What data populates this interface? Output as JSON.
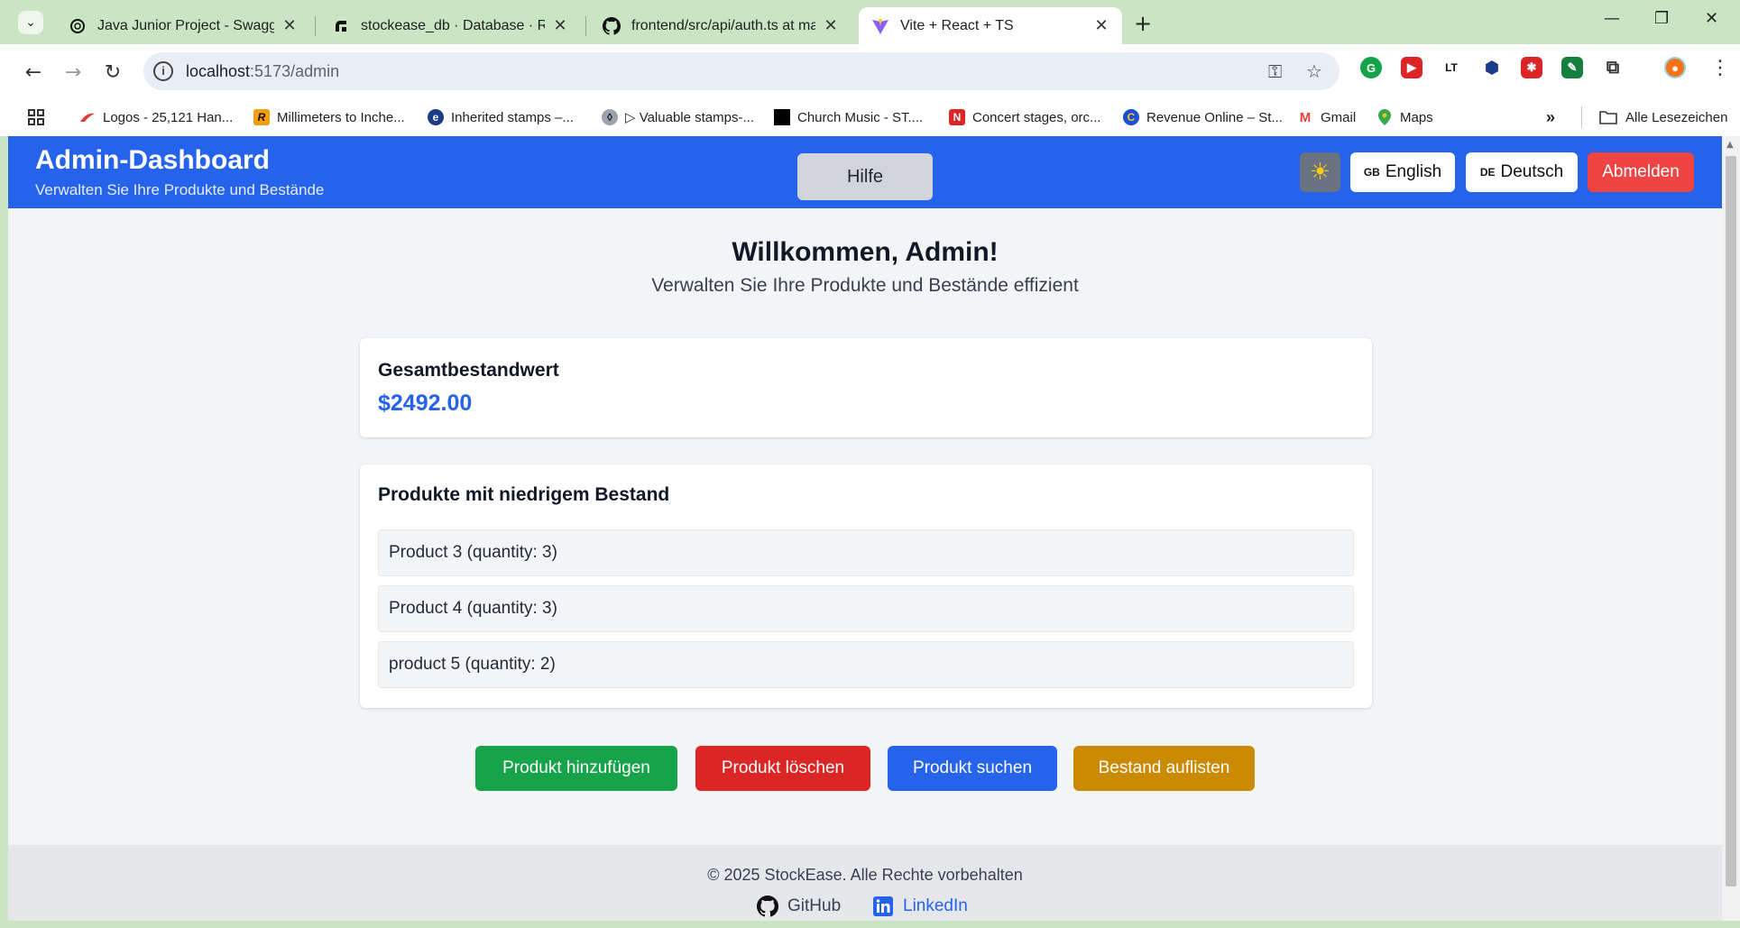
{
  "browser": {
    "tabs": [
      {
        "title": "Java Junior Project - Swagger A",
        "favicon": "openai-icon",
        "active": false
      },
      {
        "title": "stockease_db · Database · Ren",
        "favicon": "render-icon",
        "active": false
      },
      {
        "title": "frontend/src/api/auth.ts at mast",
        "favicon": "github-icon",
        "active": false
      },
      {
        "title": "Vite + React + TS",
        "favicon": "vite-icon",
        "active": true
      }
    ],
    "url_host": "localhost",
    "url_path": ":5173/admin",
    "bookmarks": [
      {
        "label": "Logos - 25,121 Han...",
        "icon": "logos-icon",
        "color": "#e23a3a"
      },
      {
        "label": "Millimeters to Inche...",
        "icon": "r-icon",
        "glyph": "R",
        "color": "#f59e0b"
      },
      {
        "label": "Inherited stamps –...",
        "icon": "stamp-icon",
        "glyph": "e",
        "color": "#1e3a8a"
      },
      {
        "label": "▷ Valuable stamps-...",
        "icon": "drop-icon",
        "glyph": "◊",
        "color": "#6b7280"
      },
      {
        "label": "Church Music - ST....",
        "icon": "black-square-icon",
        "color": "#000000"
      },
      {
        "label": "Concert stages, orc...",
        "icon": "n-icon",
        "glyph": "N",
        "color": "#dc2626"
      },
      {
        "label": "Revenue Online – St...",
        "icon": "colorado-icon",
        "glyph": "C",
        "color": "#1d4ed8"
      },
      {
        "label": "Gmail",
        "icon": "gmail-icon",
        "glyph": "M",
        "color": "#ea4335"
      },
      {
        "label": "Maps",
        "icon": "maps-icon",
        "glyph": "●",
        "color": "#34a853"
      }
    ],
    "all_bookmarks_label": "Alle Lesezeichen"
  },
  "header": {
    "title": "Admin-Dashboard",
    "subtitle": "Verwalten Sie Ihre Produkte und Bestände",
    "help_label": "Hilfe",
    "lang_en_code": "GB",
    "lang_en_label": "English",
    "lang_de_code": "DE",
    "lang_de_label": "Deutsch",
    "logout_label": "Abmelden"
  },
  "main": {
    "welcome": "Willkommen, Admin!",
    "welcome_sub": "Verwalten Sie Ihre Produkte und Bestände effizient",
    "total_title": "Gesamtbestandwert",
    "total_value": "$2492.00",
    "low_title": "Produkte mit niedrigem Bestand",
    "low_items": [
      "Product 3 (quantity: 3)",
      "Product 4 (quantity: 3)",
      "product 5 (quantity: 2)"
    ],
    "actions": [
      {
        "label": "Produkt hinzufügen",
        "color": "#16a34a"
      },
      {
        "label": "Produkt löschen",
        "color": "#dc2626"
      },
      {
        "label": "Produkt suchen",
        "color": "#2563eb"
      },
      {
        "label": "Bestand auflisten",
        "color": "#ca8a04"
      }
    ]
  },
  "footer": {
    "copyright": "© 2025 StockEase. Alle Rechte vorbehalten",
    "github_label": "GitHub",
    "linkedin_label": "LinkedIn"
  },
  "colors": {
    "header_bg": "#2563eb",
    "page_bg": "#f3f4f6",
    "link_blue": "#2563eb"
  }
}
